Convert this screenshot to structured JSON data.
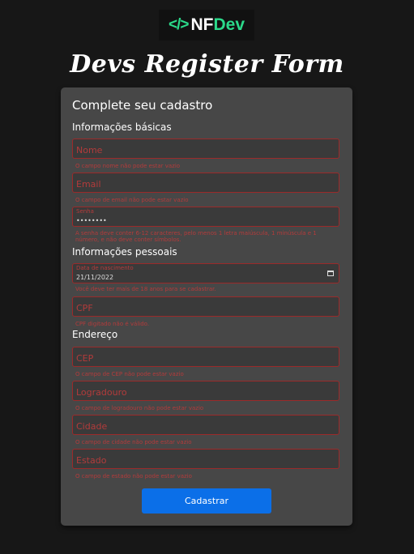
{
  "logo": {
    "code": "</>",
    "nf": "NF",
    "dev": "Dev"
  },
  "title": "Devs Register Form",
  "form": {
    "heading": "Complete seu cadastro",
    "sections": {
      "basic": "Informações básicas",
      "personal": "Informações pessoais",
      "address": "Endereço"
    },
    "fields": {
      "nome": {
        "placeholder": "Nome",
        "error": "O campo nome não pode estar vazio"
      },
      "email": {
        "placeholder": "Email",
        "error": "O campo de email não pode estar vazio"
      },
      "senha": {
        "label": "Senha",
        "value": "••••••••",
        "error": "A senha deve conter 6-12 caracteres, pelo menos 1 letra maiúscula, 1 minúscula e 1 número, e não deve conter símbolos."
      },
      "nascimento": {
        "label": "Data de nascimento",
        "value": "21/11/2022",
        "error": "Você deve ter mais de 18 anos para se cadastrar."
      },
      "cpf": {
        "placeholder": "CPF",
        "error": "CPF digitado não é válido."
      },
      "cep": {
        "placeholder": "CEP",
        "error": "O campo de CEP não pode estar vazio"
      },
      "logradouro": {
        "placeholder": "Logradouro",
        "error": "O campo de logradouro não pode estar vazio"
      },
      "cidade": {
        "placeholder": "Cidade",
        "error": "O campo de cidade não pode estar vazio"
      },
      "estado": {
        "placeholder": "Estado",
        "error": "O campo de estado não pode estar vazio"
      }
    },
    "submit_label": "Cadastrar"
  },
  "colors": {
    "background": "#171717",
    "card": "#474747",
    "error": "#b33b3b",
    "accent_green": "#2bd98a",
    "button": "#0b6fe8"
  }
}
